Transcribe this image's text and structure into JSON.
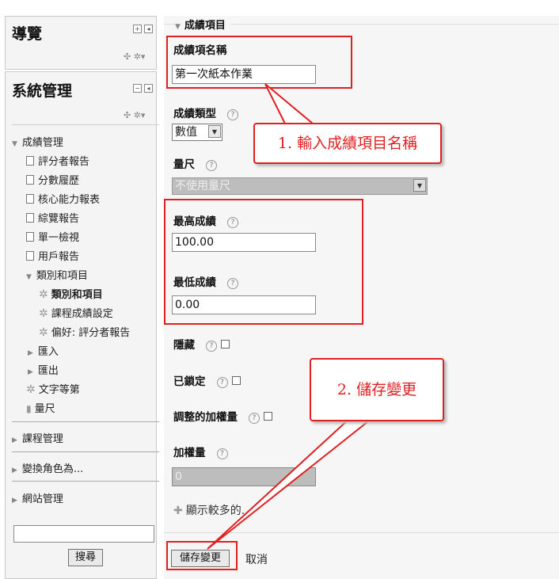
{
  "sidebar": {
    "nav_block": {
      "title": "導覽"
    },
    "admin_block": {
      "title": "系統管理",
      "tree": {
        "grade_admin": "成績管理",
        "items": [
          "評分者報告",
          "分數履歷",
          "核心能力報表",
          "綜覽報告",
          "單一檢視",
          "用戶報告"
        ],
        "categories": "類別和項目",
        "sub_items": [
          "類別和項目",
          "課程成績設定",
          "偏好: 評分者報告"
        ],
        "import": "匯入",
        "export": "匯出",
        "letters": "文字等第",
        "scales": "量尺"
      },
      "course_admin": "課程管理",
      "switch_role": "變換角色為...",
      "site_admin": "網站管理",
      "search": {
        "value": "",
        "button": "搜尋"
      }
    }
  },
  "form": {
    "section_title": "成績項目",
    "item_name": {
      "label": "成績項名稱",
      "value": "第一次紙本作業"
    },
    "grade_type": {
      "label": "成績類型",
      "value": "數值"
    },
    "scale": {
      "label": "量尺",
      "value": "不使用量尺"
    },
    "max_grade": {
      "label": "最高成績",
      "value": "100.00"
    },
    "min_grade": {
      "label": "最低成績",
      "value": "0.00"
    },
    "hidden": {
      "label": "隱藏"
    },
    "locked": {
      "label": "已鎖定"
    },
    "adjusted_weight": {
      "label": "調整的加權量"
    },
    "weight": {
      "label": "加權量",
      "value": "0"
    },
    "show_more": "顯示較多的...",
    "save_button": "儲存變更",
    "cancel": "取消"
  },
  "annotations": {
    "callout1": "1. 輸入成績項目名稱",
    "callout2": "2. 儲存變更"
  },
  "colors": {
    "annotation_red": "#e02020"
  }
}
